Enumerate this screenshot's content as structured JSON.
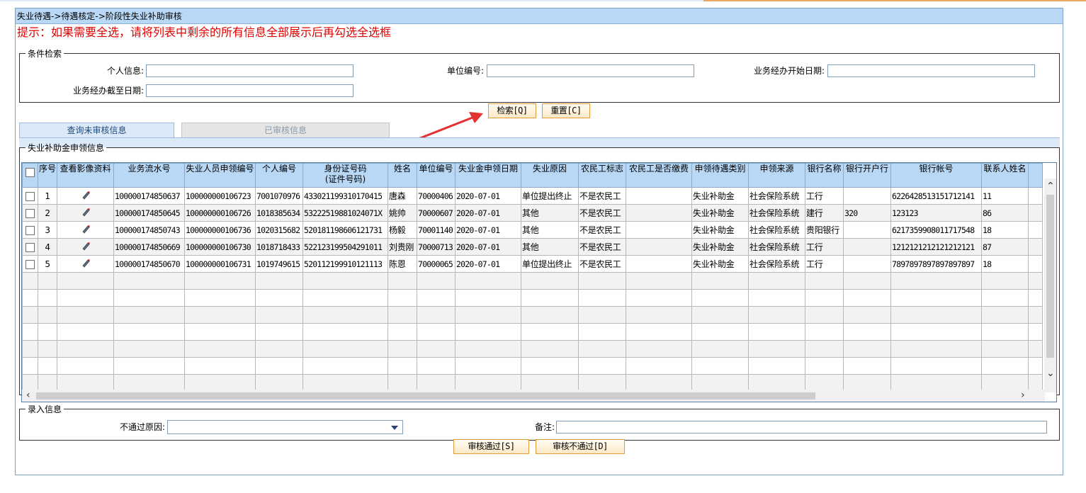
{
  "breadcrumb": "失业待遇->待遇核定->阶段性失业补助审核",
  "tip": "提示：如果需要全选，请将列表中剩余的所有信息全部展示后再勾选全选框",
  "search": {
    "legend": "条件检索",
    "personal_info_label": "个人信息:",
    "unit_no_label": "单位编号:",
    "start_date_label": "业务经办开始日期:",
    "end_date_label": "业务经办截至日期:",
    "personal_info_value": "",
    "unit_no_value": "",
    "start_date_value": "",
    "end_date_value": "",
    "search_btn": "检索[Q]",
    "reset_btn": "重置[C]"
  },
  "tabs": [
    "查询未审核信息",
    "已审核信息"
  ],
  "grid": {
    "legend": "失业补助金申领信息",
    "headers": [
      "序号",
      "查看影像资料",
      "业务流水号",
      "失业人员申领编号",
      "个人编号",
      "身份证号码",
      "姓名",
      "单位编号",
      "失业金申领日期",
      "失业原因",
      "农民工标志",
      "农民工是否缴费",
      "申领待遇类别",
      "申领来源",
      "银行名称",
      "银行开户行",
      "银行帐号",
      "联系人姓名"
    ],
    "id_subheader": "(证件号码)",
    "rows": [
      {
        "no": "1",
        "serial": "100000174850637",
        "apply_no": "100000000106723",
        "person_no": "7001070976",
        "id_no": "433021199310170415",
        "name": "唐森",
        "unit_no": "70000406",
        "date": "2020-07-01",
        "reason": "单位提出终止",
        "migrant": "不是农民工",
        "migrant_paid": "",
        "type": "失业补助金",
        "source": "社会保险系统",
        "bank": "工行",
        "branch": "",
        "account": "6226428513151712141",
        "contact": "11"
      },
      {
        "no": "2",
        "serial": "100000174850645",
        "apply_no": "100000000106726",
        "person_no": "1018385634",
        "id_no": "53222519881024071X",
        "name": "姚帅",
        "unit_no": "70000607",
        "date": "2020-07-01",
        "reason": "其他",
        "migrant": "不是农民工",
        "migrant_paid": "",
        "type": "失业补助金",
        "source": "社会保险系统",
        "bank": "建行",
        "branch": "320",
        "account": "123123",
        "contact": "86"
      },
      {
        "no": "3",
        "serial": "100000174850743",
        "apply_no": "100000000106736",
        "person_no": "1020315682",
        "id_no": "520181198606121731",
        "name": "杨毅",
        "unit_no": "70001140",
        "date": "2020-07-01",
        "reason": "其他",
        "migrant": "不是农民工",
        "migrant_paid": "",
        "type": "失业补助金",
        "source": "社会保险系统",
        "bank": "贵阳银行",
        "branch": "",
        "account": "6217359908011717548",
        "contact": "18"
      },
      {
        "no": "4",
        "serial": "100000174850669",
        "apply_no": "100000000106730",
        "person_no": "1018718433",
        "id_no": "522123199504291011",
        "name": "刘贵刚",
        "unit_no": "70000713",
        "date": "2020-07-01",
        "reason": "其他",
        "migrant": "不是农民工",
        "migrant_paid": "",
        "type": "失业补助金",
        "source": "社会保险系统",
        "bank": "工行",
        "branch": "",
        "account": "1212121212121212121",
        "contact": "87"
      },
      {
        "no": "5",
        "serial": "100000174850670",
        "apply_no": "100000000106731",
        "person_no": "1019749615",
        "id_no": "520112199910121113",
        "name": "陈恩",
        "unit_no": "70000065",
        "date": "2020-07-01",
        "reason": "单位提出终止",
        "migrant": "不是农民工",
        "migrant_paid": "",
        "type": "失业补助金",
        "source": "社会保险系统",
        "bank": "工行",
        "branch": "",
        "account": "7897897897897897897",
        "contact": "18"
      }
    ]
  },
  "entry": {
    "legend": "录入信息",
    "reject_reason_label": "不通过原因:",
    "reject_reason_value": "",
    "remark_label": "备注:",
    "remark_value": "",
    "approve_btn": "审核通过[S]",
    "reject_btn": "审核不通过[D]"
  },
  "colors": {
    "header_bg": "#b9d8f6",
    "tip_red": "#e00000",
    "button_border": "#e39a3c",
    "annotation_arrow": "#e53030"
  }
}
